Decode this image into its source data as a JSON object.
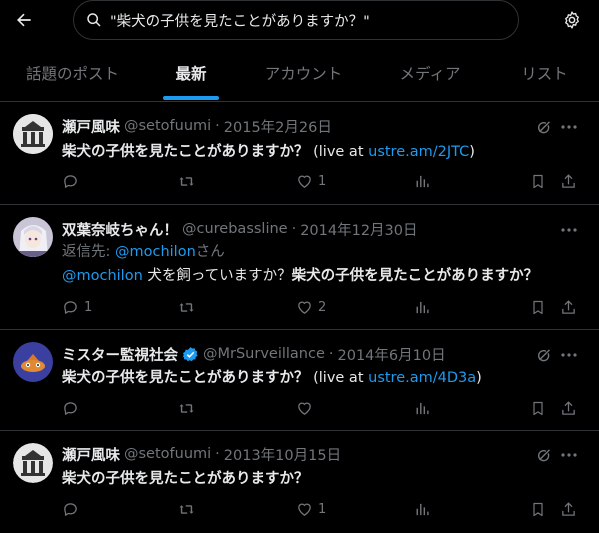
{
  "search": {
    "query": "\"柴犬の子供を見たことがありますか？\""
  },
  "tabs": [
    "話題のポスト",
    "最新",
    "アカウント",
    "メディア",
    "リスト"
  ],
  "active_tab": "最新",
  "tweets": [
    {
      "name": "瀬戸風味",
      "handle": "@setofuumi",
      "sep": "·",
      "date": "2015年2月26日",
      "text_bold": "柴犬の子供を見たことがありますか？",
      "text_pre": "(live at ",
      "link": "ustre.am/2JTC",
      "text_post": ")",
      "likes": "1"
    },
    {
      "name": "双葉奈岐ちゃん！",
      "handle": "@curebassline",
      "sep": "·",
      "date": "2014年12月30日",
      "reply_label": "返信先: ",
      "reply_handle": "@mochilon",
      "reply_suffix": "さん",
      "mention": "@mochilon",
      "text_plain": " 犬を飼っていますか？",
      "text_bold": "柴犬の子供を見たことがありますか？",
      "replies": "1",
      "likes": "2"
    },
    {
      "name": "ミスター監視社会",
      "handle": "@MrSurveillance",
      "sep": "·",
      "date": "2014年6月10日",
      "text_bold": "柴犬の子供を見たことがありますか？",
      "text_pre": "(live at ",
      "link": "ustre.am/4D3a",
      "text_post": ")"
    },
    {
      "name": "瀬戸風味",
      "handle": "@setofuumi",
      "sep": "·",
      "date": "2013年10月15日",
      "text_bold": "柴犬の子供を見たことがありますか？",
      "likes": "1"
    }
  ],
  "icons": {
    "back": "arrow-left-icon",
    "search": "search-icon",
    "settings": "gear-icon",
    "verified": "verified-badge-icon",
    "grok": "grok-icon",
    "more": "more-icon",
    "reply": "reply-icon",
    "repost": "repost-icon",
    "like": "heart-icon",
    "views": "views-icon",
    "bookmark": "bookmark-icon",
    "share": "share-icon"
  },
  "colors": {
    "background": "#000000",
    "text": "#e7e9ea",
    "muted": "#71767b",
    "accent": "#1d9bf0",
    "border": "#2f3336"
  }
}
